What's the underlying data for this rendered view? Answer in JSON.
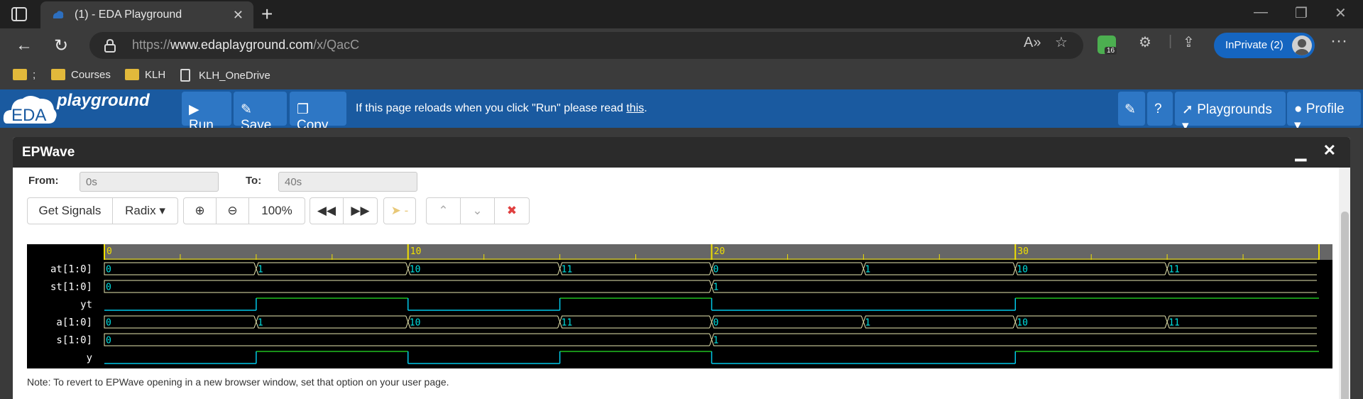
{
  "browser": {
    "tab_title": "(1) - EDA Playground",
    "url_prefix": "https://",
    "url_domain": "www.edaplayground.com",
    "url_path": "/x/QacC",
    "extension_badge": "16",
    "private_label": "InPrivate (2)",
    "favorites": [
      ";",
      "Courses",
      "KLH",
      "KLH_OneDrive"
    ]
  },
  "app": {
    "logo_text_main": "EDA",
    "logo_text_sub": "playground",
    "buttons": {
      "run": "Run",
      "save": "Save",
      "copy": "Copy",
      "playgrounds": "Playgrounds",
      "profile": "Profile"
    },
    "message": "If this page reloads when you click \"Run\" please read ",
    "message_link": "this",
    "message_end": "."
  },
  "epwave": {
    "title": "EPWave",
    "from_label": "From:",
    "from_value": "0s",
    "to_label": "To:",
    "to_value": "40s",
    "get_signals": "Get Signals",
    "radix": "Radix",
    "zoom": "100%",
    "cursor_value": "-",
    "note": "Note: To revert to EPWave opening in a new browser window, set that option on your user page."
  },
  "waveform": {
    "time_range": [
      0,
      40
    ],
    "time_labels": [
      "0",
      "10",
      "20",
      "30"
    ],
    "signals": [
      {
        "name": "at[1:0]",
        "type": "bus",
        "values": [
          "0",
          "1",
          "10",
          "11",
          "0",
          "1",
          "10",
          "11"
        ],
        "times": [
          0,
          5,
          10,
          15,
          20,
          25,
          30,
          35
        ]
      },
      {
        "name": "st[1:0]",
        "type": "bus",
        "values": [
          "0",
          "1"
        ],
        "times": [
          0,
          20
        ]
      },
      {
        "name": "yt",
        "type": "bit",
        "values": [
          0,
          1,
          0,
          1,
          0,
          1
        ],
        "times": [
          0,
          5,
          10,
          15,
          20,
          30
        ]
      },
      {
        "name": "a[1:0]",
        "type": "bus",
        "values": [
          "0",
          "1",
          "10",
          "11",
          "0",
          "1",
          "10",
          "11"
        ],
        "times": [
          0,
          5,
          10,
          15,
          20,
          25,
          30,
          35
        ]
      },
      {
        "name": "s[1:0]",
        "type": "bus",
        "values": [
          "0",
          "1"
        ],
        "times": [
          0,
          20
        ]
      },
      {
        "name": "y",
        "type": "bit",
        "values": [
          0,
          1,
          0,
          1,
          0,
          1
        ],
        "times": [
          0,
          5,
          10,
          15,
          20,
          30
        ]
      }
    ],
    "colors": {
      "background": "#000000",
      "ruler": "#666666",
      "tick": "#f0e000",
      "bus_line": "#e8e8b0",
      "bus_text": "#00e0e0",
      "bit_low": "#00c8e8",
      "bit_high": "#20c020",
      "signal_name": "#ffffff"
    }
  }
}
